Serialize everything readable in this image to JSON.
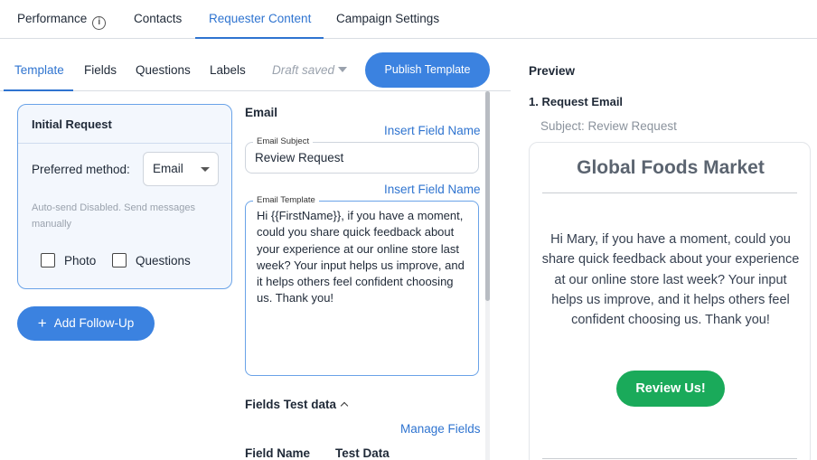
{
  "top_tabs": [
    "Performance",
    "Contacts",
    "Requester Content",
    "Campaign Settings"
  ],
  "top_tab_info_icon": "i",
  "sub_tabs": [
    "Template",
    "Fields",
    "Questions",
    "Labels"
  ],
  "draft_status": "Draft saved",
  "publish_label": "Publish Template",
  "preview_label": "Preview",
  "initial_request": {
    "title": "Initial Request",
    "preferred_method_label": "Preferred method:",
    "preferred_method_value": "Email",
    "auto_send_note": "Auto-send Disabled. Send messages manually",
    "checkbox_photo": "Photo",
    "checkbox_questions": "Questions"
  },
  "add_follow_up_label": "Add Follow-Up",
  "email": {
    "heading": "Email",
    "insert_field_name": "Insert Field Name",
    "subject_legend": "Email Subject",
    "subject_value": "Review Request",
    "template_legend": "Email Template",
    "template_value": "Hi {{FirstName}}, if you have a moment, could you share quick feedback about your experience at our online store last week? Your input helps us improve, and it helps others feel confident choosing us. Thank you!"
  },
  "fields_test": {
    "heading": "Fields Test data",
    "manage_fields": "Manage Fields",
    "col_field_name": "Field Name",
    "col_test_data": "Test Data"
  },
  "preview": {
    "request_email_label": "1. Request Email",
    "subject_line": "Subject: Review Request",
    "brand": "Global Foods Market",
    "body": "Hi Mary, if you have a moment, could you share quick feedback about your experience at our online store last week? Your input helps us improve, and it helps others feel confident choosing us. Thank you!",
    "cta": "Review Us!"
  },
  "colors": {
    "accent": "#3b82e0",
    "active_tab": "#2f74d0",
    "cta_green": "#1aaa5a"
  }
}
